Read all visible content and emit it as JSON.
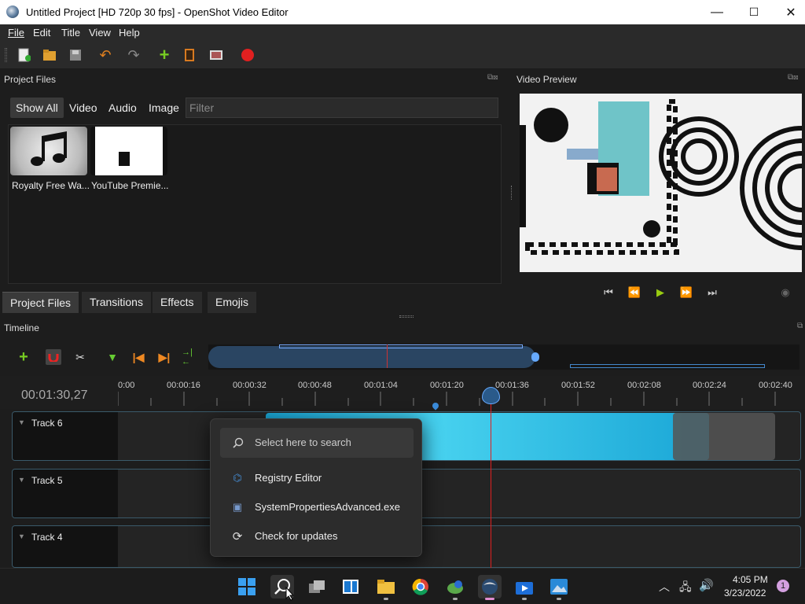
{
  "window": {
    "title": "Untitled Project [HD 720p 30 fps] - OpenShot Video Editor",
    "minimize": "—",
    "maximize": "☐",
    "close": "✕"
  },
  "menu": [
    "File",
    "Edit",
    "Title",
    "View",
    "Help"
  ],
  "toolbar": [
    "new-project-icon",
    "open-project-icon",
    "save-project-icon",
    "undo-icon",
    "redo-icon",
    "import-files-icon",
    "choose-profile-icon",
    "fullscreen-icon",
    "export-video-icon"
  ],
  "project_files": {
    "title": "Project Files",
    "filters": [
      "Show All",
      "Video",
      "Audio",
      "Image"
    ],
    "filter_placeholder": "Filter",
    "files": [
      {
        "label": "Royalty Free Wa..."
      },
      {
        "label": "YouTube Premie..."
      }
    ],
    "tabs": [
      "Project Files",
      "Transitions",
      "Effects",
      "Emojis"
    ]
  },
  "video_preview": {
    "title": "Video Preview"
  },
  "timeline": {
    "title": "Timeline",
    "current_time": "00:01:30,27",
    "ticks": [
      "0:00",
      "00:00:16",
      "00:00:32",
      "00:00:48",
      "00:01:04",
      "00:01:20",
      "00:01:36",
      "00:01:52",
      "00:02:08",
      "00:02:24",
      "00:02:40"
    ],
    "tracks": [
      "Track 6",
      "Track 5",
      "Track 4"
    ]
  },
  "start_menu": {
    "search_placeholder": "Select here to search",
    "items": [
      "Registry Editor",
      "SystemPropertiesAdvanced.exe",
      "Check for updates"
    ]
  },
  "taskbar": {
    "time": "4:05 PM",
    "date": "3/23/2022",
    "notification_count": "1",
    "apps": [
      "start-icon",
      "search-icon",
      "task-view-icon",
      "widgets-icon",
      "file-explorer-icon",
      "chrome-icon",
      "app-icon",
      "openshot-icon",
      "video-app-icon",
      "photos-icon"
    ]
  }
}
